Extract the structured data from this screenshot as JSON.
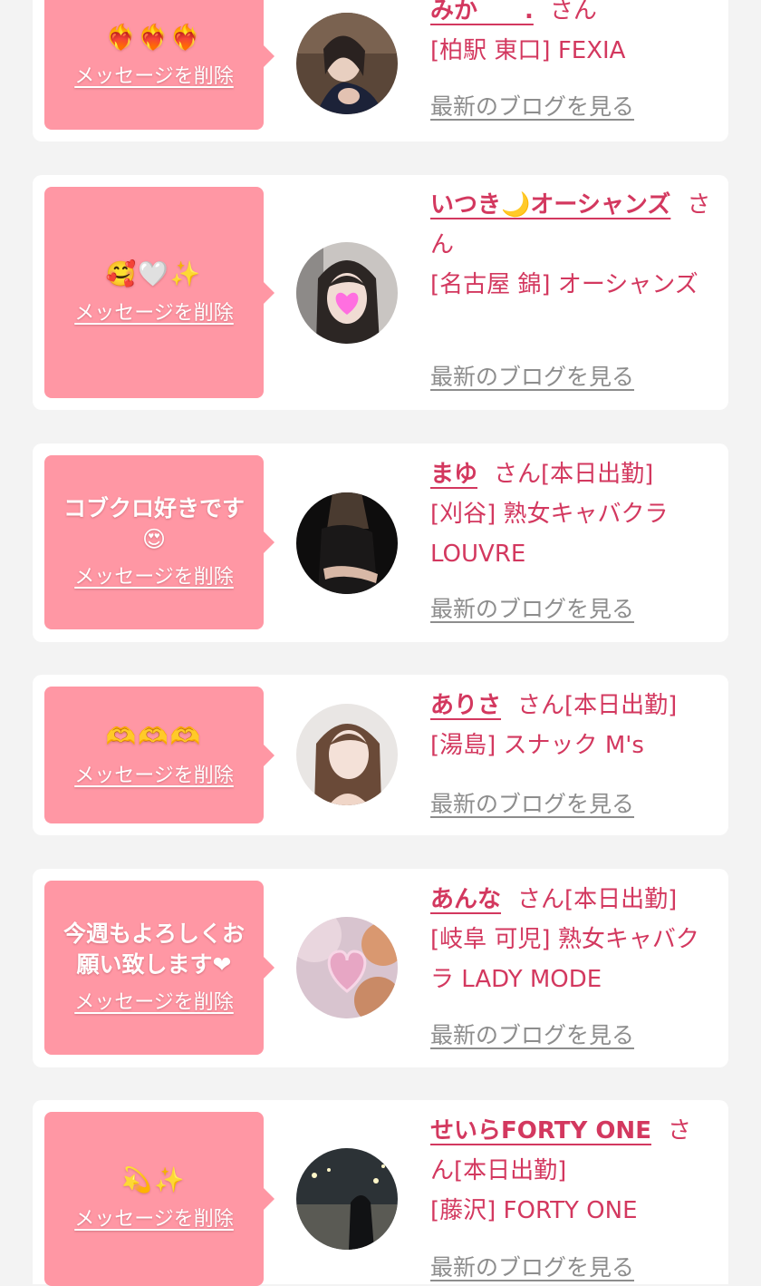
{
  "common": {
    "delete_label": "メッセージを削除",
    "blog_label": "最新のブログを見る",
    "san_label": "さん",
    "accent_color": "#d3385f",
    "bubble_color": "#ff97a4"
  },
  "entries": [
    {
      "message": "❤️‍🔥❤️‍🔥❤️‍🔥",
      "name": "みか　　.",
      "status": "",
      "shop": "[柏駅 東口] FEXIA"
    },
    {
      "message": "🥰🤍✨",
      "name": "いつき🌙オーシャンズ",
      "status": "",
      "shop": "[名古屋 錦] オーシャンズ"
    },
    {
      "message": "コブクロ好きです😍",
      "name": "まゆ",
      "status": "[本日出勤]",
      "shop": "[刈谷] 熟女キャバクラ LOUVRE"
    },
    {
      "message": "🫶🫶🫶",
      "name": "ありさ",
      "status": "[本日出勤]",
      "shop": "[湯島] スナック M's"
    },
    {
      "message": "今週もよろしくお願い致します❤",
      "name": "あんな",
      "status": "[本日出勤]",
      "shop": "[岐阜 可児] 熟女キャバクラ LADY MODE"
    },
    {
      "message": "💫✨",
      "name": "せいらFORTY ONE",
      "status": "[本日出勤]",
      "shop": "[藤沢] FORTY ONE"
    }
  ]
}
